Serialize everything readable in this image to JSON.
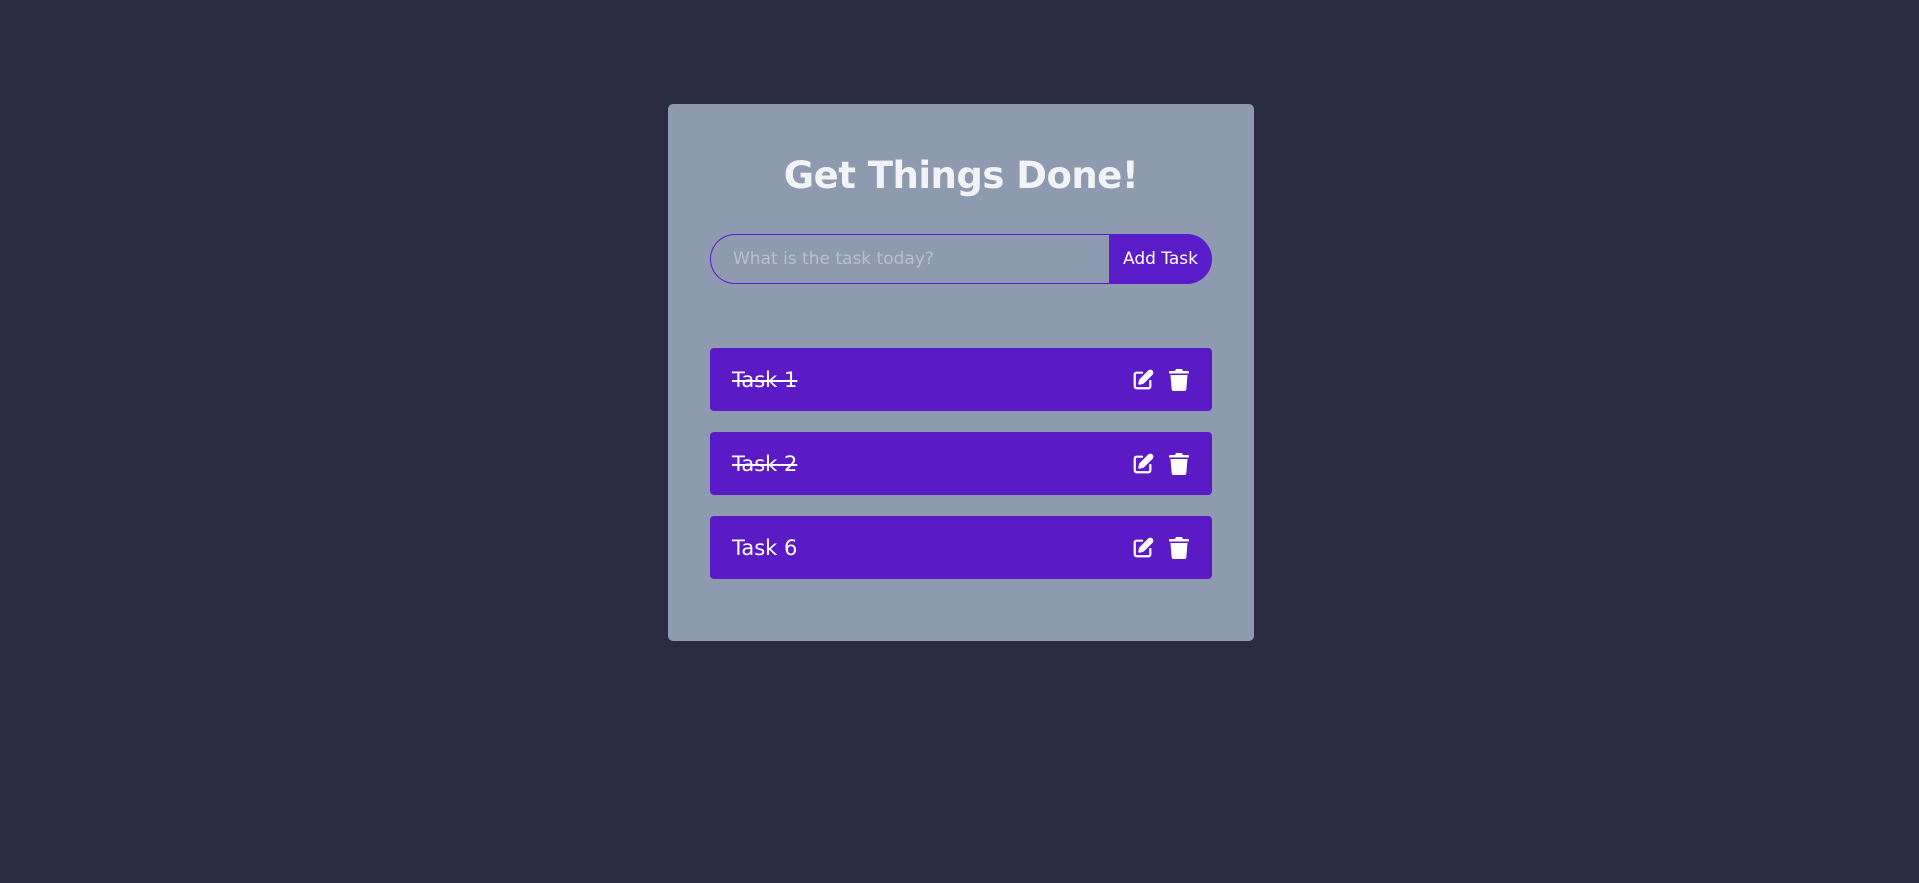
{
  "app": {
    "title": "Get Things Done!"
  },
  "form": {
    "input_value": "",
    "input_placeholder": "What is the task today?",
    "add_button_label": "Add Task"
  },
  "tasks": [
    {
      "label": "Task 1",
      "completed": true,
      "edit_icon": "edit-icon",
      "delete_icon": "trash-icon"
    },
    {
      "label": "Task 2",
      "completed": true,
      "edit_icon": "edit-icon",
      "delete_icon": "trash-icon"
    },
    {
      "label": "Task 6",
      "completed": false,
      "edit_icon": "edit-icon",
      "delete_icon": "trash-icon"
    }
  ],
  "colors": {
    "background": "#2b2c42",
    "card": "#8d9ab0",
    "accent": "#5a1bc6",
    "text": "#ffffff"
  }
}
